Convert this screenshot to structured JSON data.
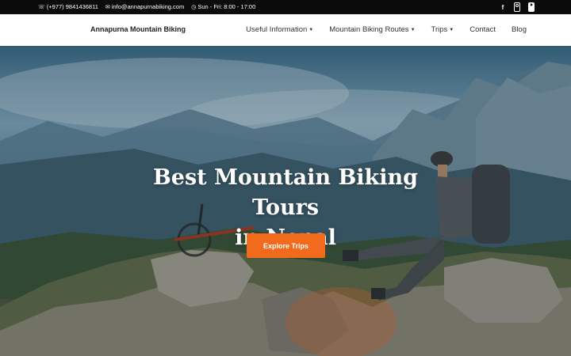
{
  "topbar": {
    "phone_icon": "phone-icon",
    "phone": "(+977) 9841436811",
    "email_icon": "mail-icon",
    "email": "info@annapurnabiking.com",
    "hours_icon": "clock-icon",
    "hours": "Sun - Fri: 8:00 - 17:00",
    "social": [
      "facebook-icon",
      "instagram-icon",
      "youtube-icon"
    ]
  },
  "header": {
    "logo": "Annapurna Mountain Biking",
    "nav": [
      {
        "label": "Useful Information",
        "dropdown": true
      },
      {
        "label": "Mountain Biking Routes",
        "dropdown": true
      },
      {
        "label": "Trips",
        "dropdown": true
      },
      {
        "label": "Contact",
        "dropdown": false
      },
      {
        "label": "Blog",
        "dropdown": false
      }
    ]
  },
  "hero": {
    "title_line1": "Best Mountain Biking Tours",
    "title_line2": "in Nepal",
    "cta_label": "Explore Trips",
    "cta_color": "#f26a1b"
  }
}
